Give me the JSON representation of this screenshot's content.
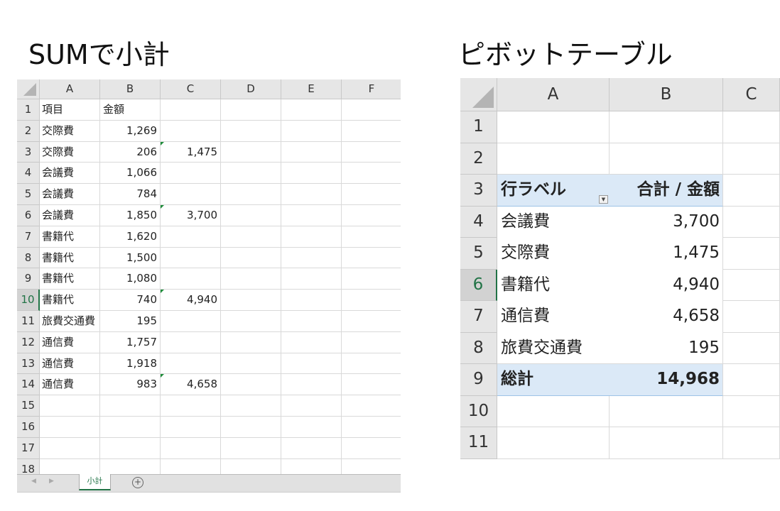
{
  "left": {
    "title": "SUMで小計",
    "columns": [
      "A",
      "B",
      "C",
      "D",
      "E",
      "F"
    ],
    "rows": [
      {
        "n": "1",
        "a": "項目",
        "b": "金額",
        "c": ""
      },
      {
        "n": "2",
        "a": "交際費",
        "b": "1,269",
        "c": ""
      },
      {
        "n": "3",
        "a": "交際費",
        "b": "206",
        "c": "1,475"
      },
      {
        "n": "4",
        "a": "会議費",
        "b": "1,066",
        "c": ""
      },
      {
        "n": "5",
        "a": "会議費",
        "b": "784",
        "c": ""
      },
      {
        "n": "6",
        "a": "会議費",
        "b": "1,850",
        "c": "3,700"
      },
      {
        "n": "7",
        "a": "書籍代",
        "b": "1,620",
        "c": ""
      },
      {
        "n": "8",
        "a": "書籍代",
        "b": "1,500",
        "c": ""
      },
      {
        "n": "9",
        "a": "書籍代",
        "b": "1,080",
        "c": ""
      },
      {
        "n": "10",
        "a": "書籍代",
        "b": "740",
        "c": "4,940"
      },
      {
        "n": "11",
        "a": "旅費交通費",
        "b": "195",
        "c": ""
      },
      {
        "n": "12",
        "a": "通信費",
        "b": "1,757",
        "c": ""
      },
      {
        "n": "13",
        "a": "通信費",
        "b": "1,918",
        "c": ""
      },
      {
        "n": "14",
        "a": "通信費",
        "b": "983",
        "c": "4,658"
      },
      {
        "n": "15",
        "a": "",
        "b": "",
        "c": ""
      },
      {
        "n": "16",
        "a": "",
        "b": "",
        "c": ""
      },
      {
        "n": "17",
        "a": "",
        "b": "",
        "c": ""
      },
      {
        "n": "18",
        "a": "",
        "b": "",
        "c": ""
      }
    ],
    "selected_row": "10",
    "sheet_tab": "小計",
    "add_sheet_icon": "plus-circle-icon"
  },
  "right": {
    "title": "ピボットテーブル",
    "columns": [
      "A",
      "B",
      "C"
    ],
    "rows": [
      {
        "n": "1",
        "a": "",
        "b": ""
      },
      {
        "n": "2",
        "a": "",
        "b": ""
      },
      {
        "n": "3",
        "a": "行ラベル",
        "b": "合計 / 金額",
        "type": "header"
      },
      {
        "n": "4",
        "a": "会議費",
        "b": "3,700",
        "type": "item"
      },
      {
        "n": "5",
        "a": "交際費",
        "b": "1,475",
        "type": "item"
      },
      {
        "n": "6",
        "a": "書籍代",
        "b": "4,940",
        "type": "item"
      },
      {
        "n": "7",
        "a": "通信費",
        "b": "4,658",
        "type": "item"
      },
      {
        "n": "8",
        "a": "旅費交通費",
        "b": "195",
        "type": "item"
      },
      {
        "n": "9",
        "a": "総計",
        "b": "14,968",
        "type": "total"
      },
      {
        "n": "10",
        "a": "",
        "b": ""
      },
      {
        "n": "11",
        "a": "",
        "b": ""
      }
    ],
    "selected_row": "6",
    "pivot_fill": "#dbe9f7",
    "filter_icon": "dropdown-filter-icon"
  }
}
